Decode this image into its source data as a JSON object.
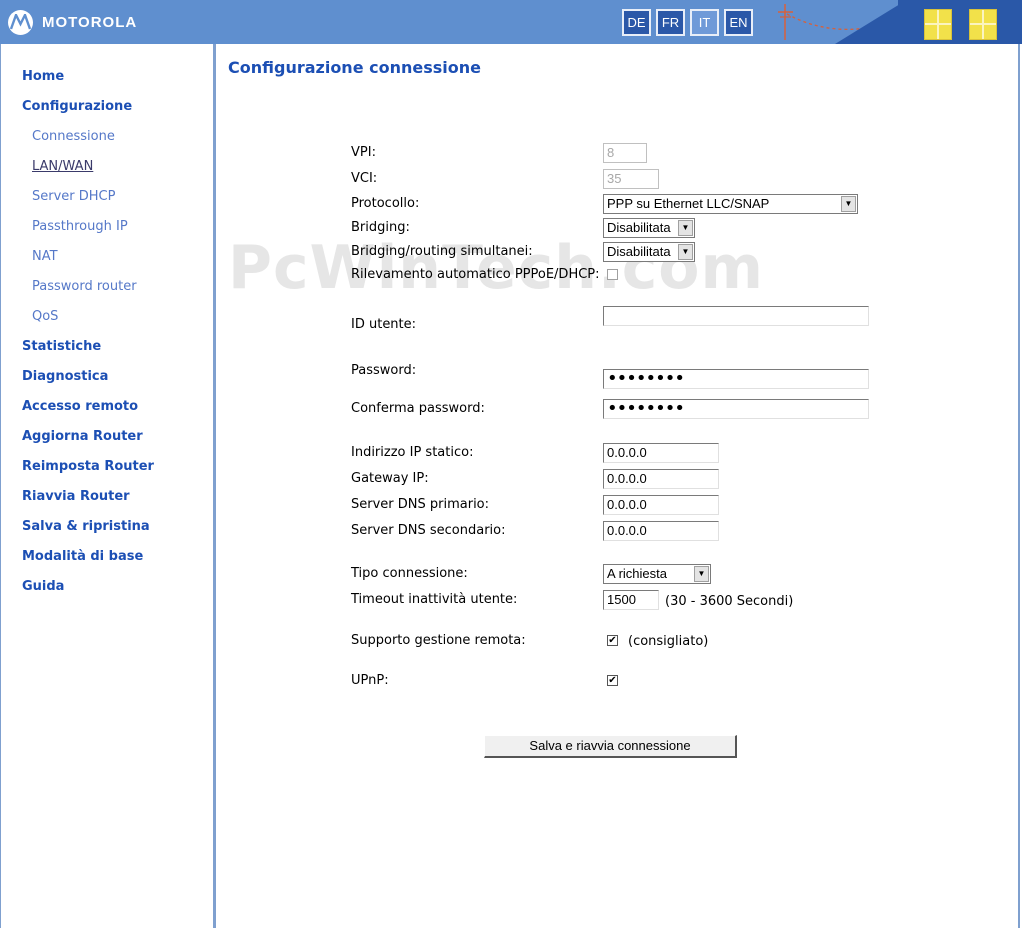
{
  "header": {
    "brand": "MOTOROLA",
    "languages": [
      "DE",
      "FR",
      "IT",
      "EN"
    ],
    "active_language": "IT"
  },
  "sidebar": {
    "items": [
      {
        "label": "Home",
        "level": "top"
      },
      {
        "label": "Configurazione",
        "level": "top"
      },
      {
        "label": "Connessione",
        "level": "sub"
      },
      {
        "label": "LAN/WAN",
        "level": "sub",
        "current": true
      },
      {
        "label": "Server DHCP",
        "level": "sub"
      },
      {
        "label": "Passthrough IP",
        "level": "sub"
      },
      {
        "label": "NAT",
        "level": "sub"
      },
      {
        "label": "Password router",
        "level": "sub"
      },
      {
        "label": "QoS",
        "level": "sub"
      },
      {
        "label": "Statistiche",
        "level": "top"
      },
      {
        "label": "Diagnostica",
        "level": "top"
      },
      {
        "label": "Accesso remoto",
        "level": "top"
      },
      {
        "label": "Aggiorna Router",
        "level": "top"
      },
      {
        "label": "Reimposta Router",
        "level": "top"
      },
      {
        "label": "Riavvia Router",
        "level": "top"
      },
      {
        "label": "Salva & ripristina",
        "level": "top"
      },
      {
        "label": "Modalità di base",
        "level": "top"
      },
      {
        "label": "Guida",
        "level": "top"
      }
    ]
  },
  "main": {
    "title": "Configurazione connessione",
    "watermark": "PcWinTech.com",
    "form": {
      "vpi": {
        "label": "VPI:",
        "value": "8"
      },
      "vci": {
        "label": "VCI:",
        "value": "35"
      },
      "protocol": {
        "label": "Protocollo:",
        "value": "PPP su Ethernet LLC/SNAP"
      },
      "bridging": {
        "label": "Bridging:",
        "value": "Disabilitata"
      },
      "simultaneous": {
        "label": "Bridging/routing simultanei:",
        "value": "Disabilitata"
      },
      "autodetect": {
        "label": "Rilevamento automatico PPPoE/DHCP:",
        "checked": false
      },
      "user_id": {
        "label": "ID utente:",
        "value": ""
      },
      "password": {
        "label": "Password:",
        "value": "••••••••"
      },
      "confirm_password": {
        "label": "Conferma password:",
        "value": "••••••••"
      },
      "static_ip": {
        "label": "Indirizzo IP statico:",
        "value": "0.0.0.0"
      },
      "gateway": {
        "label": "Gateway IP:",
        "value": "0.0.0.0"
      },
      "dns_primary": {
        "label": "Server DNS primario:",
        "value": "0.0.0.0"
      },
      "dns_secondary": {
        "label": "Server DNS secondario:",
        "value": "0.0.0.0"
      },
      "connection_type": {
        "label": "Tipo connessione:",
        "value": "A richiesta"
      },
      "idle_timeout": {
        "label": "Timeout inattività utente:",
        "value": "1500",
        "hint": "(30 - 3600 Secondi)"
      },
      "remote_mgmt": {
        "label": "Supporto gestione remota:",
        "checked": true,
        "hint": "(consigliato)"
      },
      "upnp": {
        "label": "UPnP:",
        "checked": true
      }
    },
    "save_button": "Salva e riavvia connessione"
  }
}
